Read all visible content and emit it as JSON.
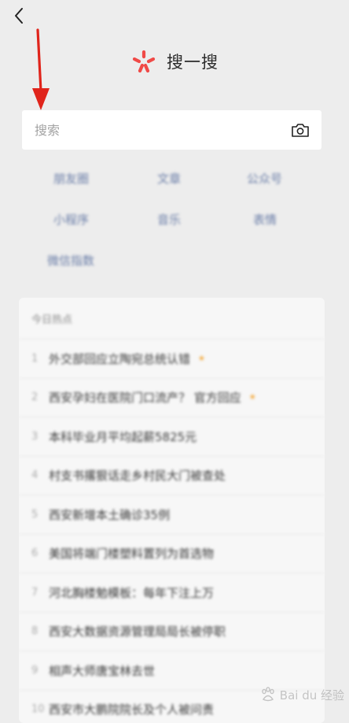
{
  "header": {
    "back_icon": "chevron-left-icon",
    "brand_icon": "sousou-logo-icon",
    "title": "搜一搜"
  },
  "search": {
    "placeholder": "搜索",
    "value": "",
    "camera_icon": "camera-icon"
  },
  "annotation": {
    "arrow_icon": "red-arrow-down-icon",
    "color": "#e0241b"
  },
  "categories": [
    "朋友圈",
    "文章",
    "公众号",
    "小程序",
    "音乐",
    "表情",
    "微信指数"
  ],
  "hot_list": {
    "header": "今日热点",
    "items": [
      {
        "rank": "1",
        "text": "外交部回应立陶宛总统认错",
        "badge": "★"
      },
      {
        "rank": "2",
        "text": "西安孕妇在医院门口流产？ 官方回应",
        "badge": "★"
      },
      {
        "rank": "3",
        "text": "本科毕业月平均起薪5825元",
        "badge": ""
      },
      {
        "rank": "4",
        "text": "村支书撂狠话走乡村民大门被查处",
        "badge": ""
      },
      {
        "rank": "5",
        "text": "西安新增本土确诊35例",
        "badge": ""
      },
      {
        "rank": "6",
        "text": "美国将端门楼塑料置列为首选物",
        "badge": ""
      },
      {
        "rank": "7",
        "text": "河北胸楼勉模板：每年下注上万",
        "badge": ""
      },
      {
        "rank": "8",
        "text": "西安大数据资源管理局局长被停职",
        "badge": ""
      },
      {
        "rank": "9",
        "text": "相声大师唐宝林去世",
        "badge": ""
      },
      {
        "rank": "10",
        "text": "西安市大鹏院院长及个人被问责",
        "badge": ""
      }
    ]
  },
  "watermark": {
    "text": "Bai du 经验",
    "icon": "paw-icon"
  },
  "colors": {
    "background": "#ededed",
    "accent_red": "#e0241b",
    "link_blue": "#6b7ea8",
    "hot_badge": "#f3a93b"
  }
}
